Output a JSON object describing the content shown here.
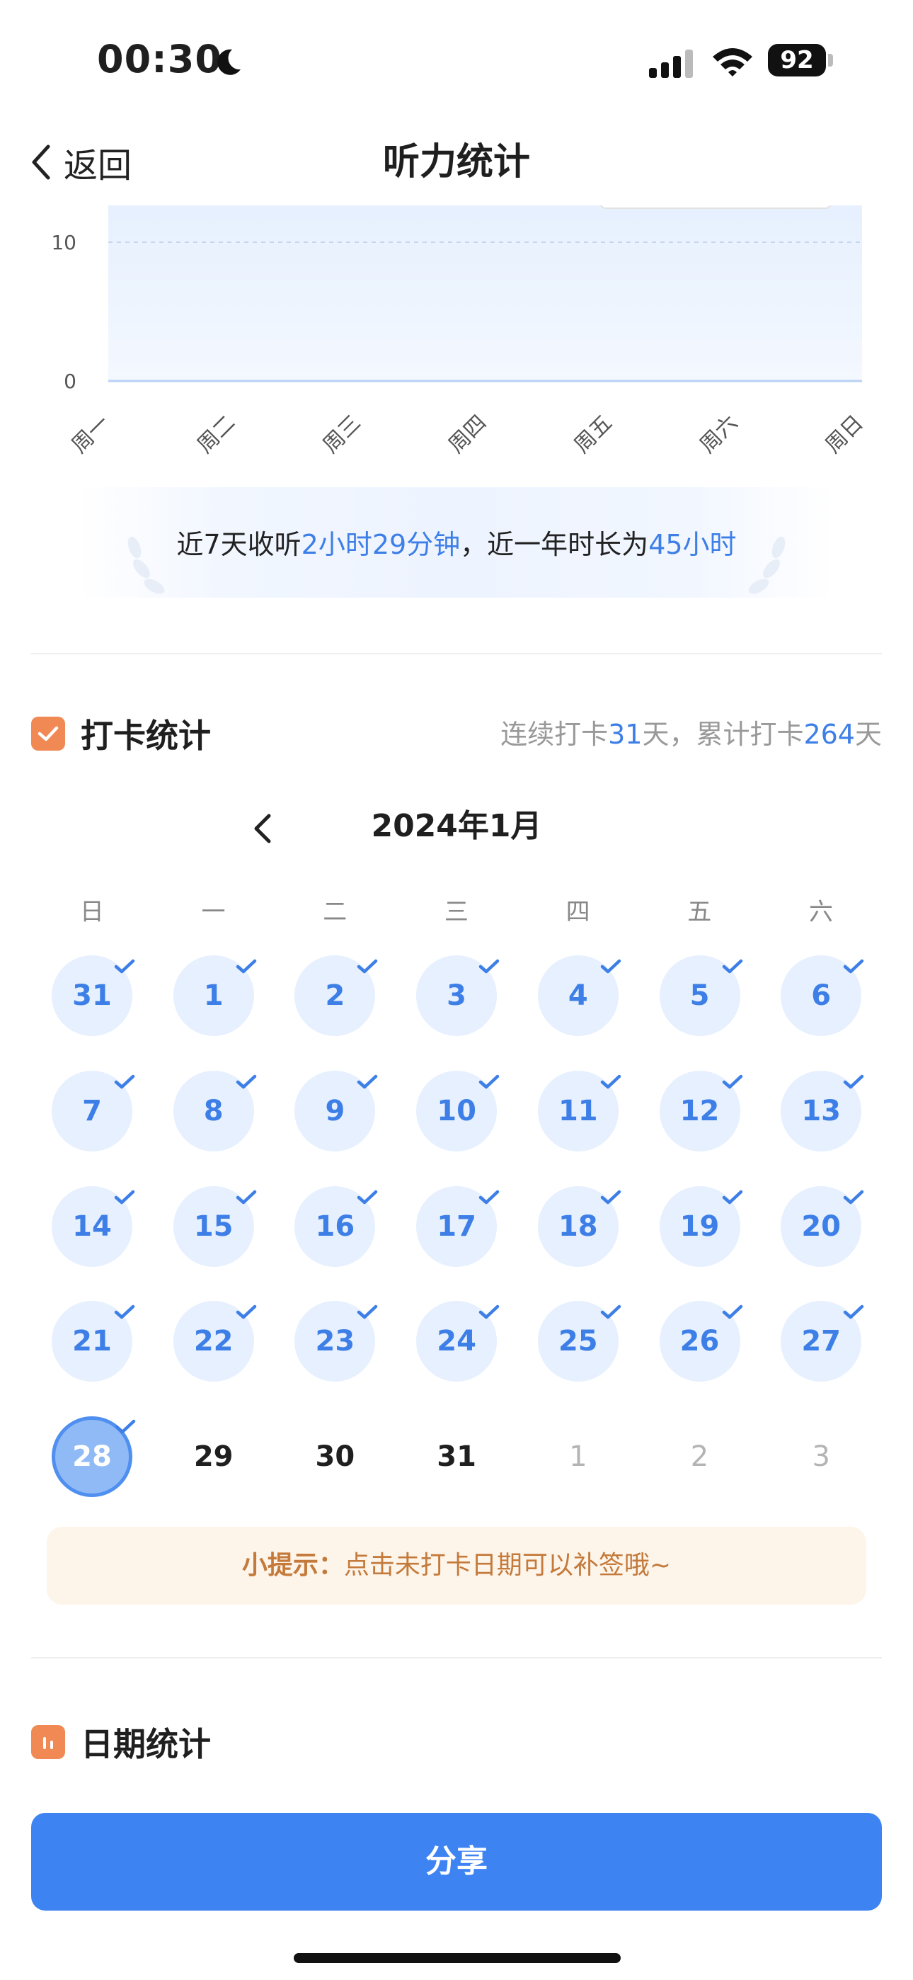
{
  "status_bar": {
    "time": "00:30",
    "battery": "92"
  },
  "nav": {
    "back_label": "返回",
    "title": "听力统计"
  },
  "chart_data": {
    "type": "area",
    "categories": [
      "周一",
      "周二",
      "周三",
      "周四",
      "周五",
      "周六",
      "周日"
    ],
    "y_ticks": [
      "0",
      "10"
    ],
    "values": [
      0,
      0,
      0,
      0,
      0,
      0,
      0
    ],
    "ylim": [
      0,
      10
    ],
    "grid": true,
    "colors": {
      "fill": "#eaf2fe",
      "line": "#c9dcf8"
    }
  },
  "summary": {
    "prefix": "近7天收听",
    "week_duration": "2小时29分钟",
    "middle": "，近一年时长为",
    "year_duration": "45小时"
  },
  "checkin": {
    "title": "打卡统计",
    "stats_prefix": "连续打卡",
    "streak_days": "31",
    "stats_mid": "天，累计打卡",
    "total_days": "264",
    "stats_suffix": "天",
    "month_label": "2024年1月",
    "weekdays": [
      "日",
      "一",
      "二",
      "三",
      "四",
      "五",
      "六"
    ],
    "weeks": [
      [
        {
          "d": "31",
          "s": "checked"
        },
        {
          "d": "1",
          "s": "checked"
        },
        {
          "d": "2",
          "s": "checked"
        },
        {
          "d": "3",
          "s": "checked"
        },
        {
          "d": "4",
          "s": "checked"
        },
        {
          "d": "5",
          "s": "checked"
        },
        {
          "d": "6",
          "s": "checked"
        }
      ],
      [
        {
          "d": "7",
          "s": "checked"
        },
        {
          "d": "8",
          "s": "checked"
        },
        {
          "d": "9",
          "s": "checked"
        },
        {
          "d": "10",
          "s": "checked"
        },
        {
          "d": "11",
          "s": "checked"
        },
        {
          "d": "12",
          "s": "checked"
        },
        {
          "d": "13",
          "s": "checked"
        }
      ],
      [
        {
          "d": "14",
          "s": "checked"
        },
        {
          "d": "15",
          "s": "checked"
        },
        {
          "d": "16",
          "s": "checked"
        },
        {
          "d": "17",
          "s": "checked"
        },
        {
          "d": "18",
          "s": "checked"
        },
        {
          "d": "19",
          "s": "checked"
        },
        {
          "d": "20",
          "s": "checked"
        }
      ],
      [
        {
          "d": "21",
          "s": "checked"
        },
        {
          "d": "22",
          "s": "checked"
        },
        {
          "d": "23",
          "s": "checked"
        },
        {
          "d": "24",
          "s": "checked"
        },
        {
          "d": "25",
          "s": "checked"
        },
        {
          "d": "26",
          "s": "checked"
        },
        {
          "d": "27",
          "s": "checked"
        }
      ],
      [
        {
          "d": "28",
          "s": "today"
        },
        {
          "d": "29",
          "s": "plain"
        },
        {
          "d": "30",
          "s": "plain"
        },
        {
          "d": "31",
          "s": "plain"
        },
        {
          "d": "1",
          "s": "other"
        },
        {
          "d": "2",
          "s": "other"
        },
        {
          "d": "3",
          "s": "other"
        }
      ]
    ],
    "tip_label": "小提示：",
    "tip_text": "点击未打卡日期可以补签哦~"
  },
  "date_stats": {
    "title": "日期统计"
  },
  "share_button": "分享",
  "colors": {
    "accent": "#3d83f2",
    "section_icon": "#f08954",
    "tip_bg": "#fdf4ea",
    "tip_text": "#c47a3a"
  }
}
